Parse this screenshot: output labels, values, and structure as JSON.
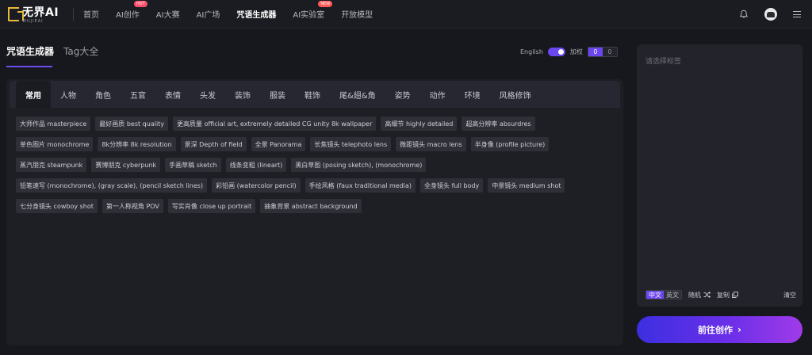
{
  "nav": {
    "logo_text": "无界AI",
    "logo_sub": "WUJIEAI",
    "items": [
      {
        "label": "首页",
        "active": false
      },
      {
        "label": "AI创作",
        "active": false,
        "badge": "HOT"
      },
      {
        "label": "AI大赛",
        "active": false
      },
      {
        "label": "AI广场",
        "active": false
      },
      {
        "label": "咒语生成器",
        "active": true
      },
      {
        "label": "AI实验室",
        "active": false,
        "badge": "NEW"
      },
      {
        "label": "开放模型",
        "active": false
      }
    ],
    "icons": [
      "bell-icon",
      "avatar",
      "menu-icon"
    ]
  },
  "page_tabs": [
    {
      "label": "咒语生成器",
      "active": true
    },
    {
      "label": "Tag大全",
      "active": false
    }
  ],
  "controls": {
    "english_label": "English",
    "english_toggle_on": true,
    "weight_label": "加权",
    "weight_value": "0",
    "weight_alt": "0"
  },
  "categories": [
    "常用",
    "人物",
    "角色",
    "五官",
    "表情",
    "头发",
    "装饰",
    "服装",
    "鞋饰",
    "尾&翅&角",
    "姿势",
    "动作",
    "环境",
    "风格修饰"
  ],
  "active_category": "常用",
  "tags": [
    "大师作品 masterpiece",
    "最好画质 best quality",
    "更高质量 official art, extremely detailed CG unity 8k wallpaper",
    "高细节 highly detailed",
    "超高分辨率 absurdres",
    "单色图片 monochrome",
    "8k分辨率 8k resolution",
    "景深 Depth of field",
    "全景 Panorama",
    "长焦镜头 telephoto lens",
    "微距镜头 macro lens",
    "半身像 (profile picture)",
    "蒸汽朋克 steampunk",
    "赛博朋克 cyberpunk",
    "手画草稿 sketch",
    "线条变粗 (lineart)",
    "黑白草图 (posing sketch), (monochrome)",
    "铅笔速写 (monochrome), (gray scale), (pencil sketch lines)",
    "彩铅画 (watercolor pencil)",
    "手绘风格 (faux traditional media)",
    "全身镜头 full body",
    "中景镜头 medium shot",
    "七分身镜头 cowboy shot",
    "第一人称视角 POV",
    "写实肖像 close up portrait",
    "抽象背景 abstract background"
  ],
  "side_panel": {
    "placeholder": "请选择标签",
    "lang_on": "中文",
    "lang_off": "英文",
    "random_label": "随机",
    "copy_label": "复制",
    "clear_label": "清空"
  },
  "go_button": {
    "label": "前往创作",
    "arrow": "›"
  },
  "colors": {
    "accent": "#6a47f0",
    "background": "#17181d",
    "panel": "#1e1f25",
    "logo": "#e8b93a",
    "badge": "#ff4d6a"
  }
}
